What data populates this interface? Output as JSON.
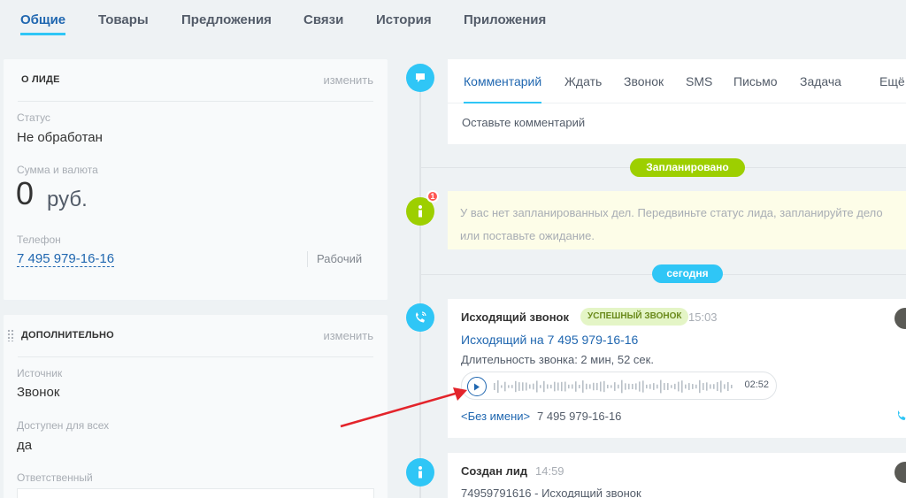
{
  "top_tabs": [
    "Общие",
    "Товары",
    "Предложения",
    "Связи",
    "История",
    "Приложения"
  ],
  "lead_card": {
    "title": "О ЛИДЕ",
    "edit": "изменить",
    "status_label": "Статус",
    "status_value": "Не обработан",
    "amount_label": "Сумма и валюта",
    "amount_value": "0",
    "currency": "руб.",
    "phone_label": "Телефон",
    "phone_value": "7 495 979-16-16",
    "phone_type": "Рабочий"
  },
  "extra_card": {
    "title": "ДОПОЛНИТЕЛЬНО",
    "edit": "изменить",
    "source_label": "Источник",
    "source_value": "Звонок",
    "access_label": "Доступен для всех",
    "access_value": "да",
    "responsible_label": "Ответственный"
  },
  "composer": {
    "tabs": [
      "Комментарий",
      "Ждать",
      "Звонок",
      "SMS",
      "Письмо",
      "Задача",
      "Ещё"
    ],
    "placeholder": "Оставьте комментарий"
  },
  "timeline": {
    "planned_label": "Запланировано",
    "badge_count": "1",
    "notice": "У вас нет запланированных дел. Передвиньте статус лида, запланируйте дело или поставьте ожидание.",
    "today_label": "сегодня"
  },
  "call_event": {
    "title": "Исходящий звонок",
    "status": "УСПЕШНЫЙ ЗВОНОК",
    "time": "15:03",
    "link": "Исходящий на 7 495 979-16-16",
    "duration": "Длительность звонка: 2 мин, 52 сек.",
    "player_time": "02:52",
    "contact_name": "<Без имени>",
    "contact_phone": "7 495 979-16-16"
  },
  "created_event": {
    "title": "Создан лид",
    "time": "14:59",
    "text": "74959791616 - Исходящий звонок"
  },
  "colors": {
    "accent_blue": "#2fc6f6",
    "link_blue": "#2067b0",
    "green": "#9dcf00",
    "annotation_arrow": "#e3242b"
  }
}
